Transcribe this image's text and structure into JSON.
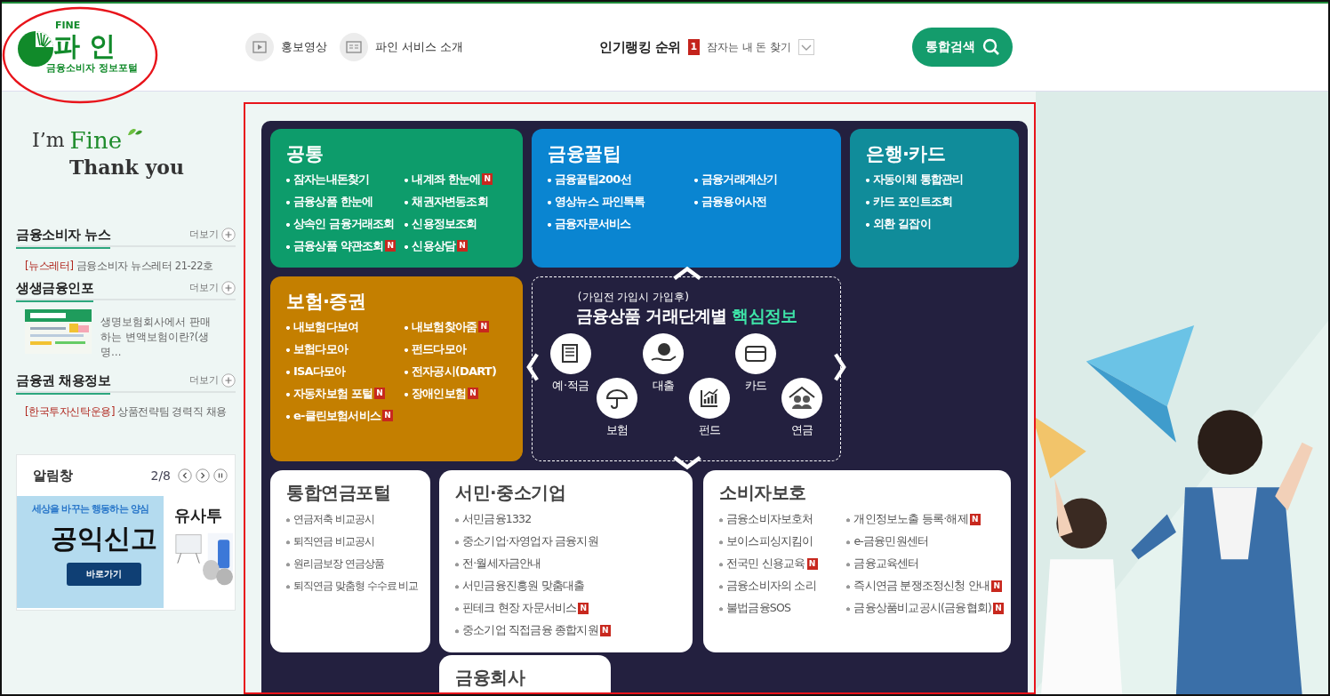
{
  "header": {
    "highlighted": true,
    "logo": {
      "small": "FINE",
      "name": "파 인",
      "tagline": "금융소비자 정보포털"
    },
    "links": [
      {
        "kind": "video",
        "label": "홍보영상"
      },
      {
        "kind": "document",
        "label": "파인 서비스 소개"
      }
    ],
    "ranking": {
      "title": "인기랭킹 순위",
      "rank": "1",
      "text": "잠자는 내 돈 찾기"
    },
    "search_button": "통합검색"
  },
  "sidebar": {
    "slogan": {
      "im": "I’m",
      "fine": "Fine",
      "thanks": "Thank you"
    },
    "sections": [
      {
        "kind": "news",
        "title": "금융소비자 뉴스",
        "more": "더보기",
        "items": [
          {
            "tag": "[뉴스레터]",
            "text": "금융소비자 뉴스레터 21-22호"
          }
        ]
      },
      {
        "kind": "thumb",
        "title": "생생금융인포",
        "more": "더보기",
        "items": [
          {
            "text": "생명보험회사에서 판매하는 변액보험이란?(생명…"
          }
        ]
      },
      {
        "kind": "news",
        "title": "금융권 채용정보",
        "more": "더보기",
        "items": [
          {
            "tag": "[한국투자신탁운용]",
            "text": "상품전략팀 경력직 채용"
          }
        ]
      }
    ],
    "notice": {
      "title": "알림창",
      "counter": "2/8",
      "banners": [
        {
          "kind": "promo",
          "subtitle": "세상을 바꾸는 행동하는 양심",
          "title": "공익신고",
          "button": "바로가기"
        },
        {
          "kind": "partial",
          "title": "유사투"
        }
      ]
    }
  },
  "menu": {
    "highlighted": true,
    "cards": [
      {
        "title": "공통",
        "color": "#0d9c6b",
        "columns": [
          [
            {
              "label": "잠자는내돈찾기"
            },
            {
              "label": "금융상품 한눈에"
            },
            {
              "label": "상속인 금융거래조회"
            },
            {
              "label": "금융상품 약관조회",
              "badge": "N"
            }
          ],
          [
            {
              "label": "내계좌 한눈에",
              "badge": "N"
            },
            {
              "label": "채권자변동조회"
            },
            {
              "label": "신용정보조회"
            },
            {
              "label": "신용상담",
              "badge": "N"
            }
          ]
        ]
      },
      {
        "title": "금융꿀팁",
        "color": "#0a85d1",
        "columns": [
          [
            {
              "label": "금융꿀팁200선"
            },
            {
              "label": "영상뉴스 파인톡톡"
            },
            {
              "label": "금융자문서비스"
            }
          ],
          [
            {
              "label": "금융거래계산기"
            },
            {
              "label": "금융용어사전"
            }
          ]
        ]
      },
      {
        "title": "은행·카드",
        "color": "#108c9a",
        "columns": [
          [
            {
              "label": "자동이체 통합관리"
            },
            {
              "label": "카드 포인트조회"
            },
            {
              "label": "외환 길잡이"
            }
          ]
        ]
      },
      {
        "title": "보험·증권",
        "color": "#c47f00",
        "columns": [
          [
            {
              "label": "내보험다보여"
            },
            {
              "label": "보험다모아"
            },
            {
              "label": "ISA다모아"
            },
            {
              "label": "자동차보험 포털",
              "badge": "N"
            },
            {
              "label": "e-클린보험서비스",
              "badge": "N"
            }
          ],
          [
            {
              "label": "내보험찾아줌",
              "badge": "N"
            },
            {
              "label": "펀드다모아"
            },
            {
              "label": "전자공시(DART)"
            },
            {
              "label": "장애인보험",
              "badge": "N"
            }
          ]
        ]
      }
    ],
    "stage": {
      "steps": "(가입전 가입시 가입후)",
      "title": "금융상품 거래단계별",
      "highlight": "핵심정보",
      "items": [
        {
          "kind": "passbook",
          "label": "예·적금"
        },
        {
          "kind": "umbrella",
          "label": "보험"
        },
        {
          "kind": "coin",
          "label": "대출"
        },
        {
          "kind": "chart",
          "label": "펀드"
        },
        {
          "kind": "card",
          "label": "카드"
        },
        {
          "kind": "elders",
          "label": "연금"
        }
      ]
    },
    "bottom_cards": [
      {
        "title": "통합연금포털",
        "columns": [
          [
            {
              "label": "연금저축 비교공시"
            },
            {
              "label": "퇴직연금 비교공시"
            },
            {
              "label": "원리금보장 연금상품"
            },
            {
              "label": "퇴직연금 맞춤형 수수료 비교"
            }
          ]
        ]
      },
      {
        "title": "서민·중소기업",
        "columns": [
          [
            {
              "label": "서민금융1332"
            },
            {
              "label": "중소기업·자영업자 금융지원"
            },
            {
              "label": "전·월세자금안내"
            },
            {
              "label": "서민금융진흥원 맞춤대출"
            },
            {
              "label": "핀테크 현장 자문서비스",
              "badge": "N"
            },
            {
              "label": "중소기업 직접금융 종합지원",
              "badge": "N"
            }
          ]
        ]
      },
      {
        "title": "소비자보호",
        "columns": [
          [
            {
              "label": "금융소비자보호처"
            },
            {
              "label": "보이스피싱지킴이"
            },
            {
              "label": "전국민 신용교육",
              "badge": "N"
            },
            {
              "label": "금융소비자의 소리"
            },
            {
              "label": "불법금융SOS"
            }
          ],
          [
            {
              "label": "개인정보노출 등록·해제",
              "badge": "N"
            },
            {
              "label": "e-금융민원센터"
            },
            {
              "label": "금융교육센터"
            },
            {
              "label": "즉시연금 분쟁조정신청 안내",
              "badge": "N"
            },
            {
              "label": "금융상품비교공시(금융협회)",
              "badge": "N"
            }
          ]
        ]
      },
      {
        "title": "금융회사"
      }
    ]
  }
}
